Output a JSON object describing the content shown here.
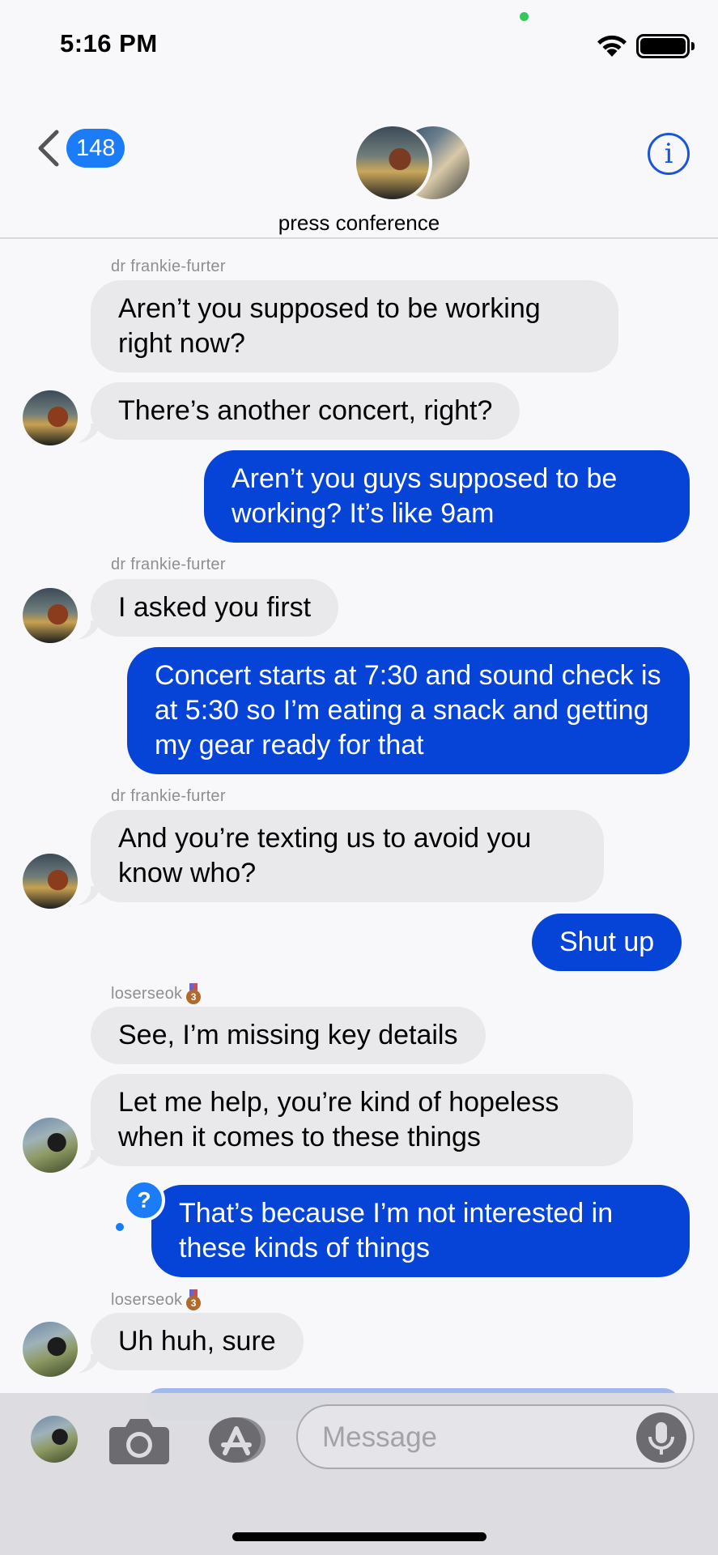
{
  "status_bar": {
    "time": "5:16 PM"
  },
  "header": {
    "back_count": "148",
    "group_name": "press conference",
    "info_label": "i"
  },
  "messages": [
    {
      "sender": "dr frankie-furter",
      "text": "Aren’t you supposed to be working right now?"
    },
    {
      "text": "There’s another concert, right?"
    },
    {
      "text": "Aren’t you guys supposed to be working? It’s like 9am"
    },
    {
      "sender": "dr frankie-furter",
      "text": "I asked you first"
    },
    {
      "text": "Concert starts at 7:30 and sound check is at 5:30 so I’m eating a snack and getting my gear ready for that"
    },
    {
      "sender": "dr frankie-furter",
      "text": "And you’re texting us to avoid you know who?"
    },
    {
      "text": "Shut up"
    },
    {
      "sender": "loserseok",
      "text": "See, I’m missing key details"
    },
    {
      "text": "Let me help, you’re kind of hopeless when it comes to these things"
    },
    {
      "text": "That’s because I’m not interested in these kinds of things",
      "badge": "?"
    },
    {
      "sender": "loserseok",
      "text": "Uh huh, sure"
    }
  ],
  "input": {
    "placeholder": "Message"
  },
  "icons": {
    "back": "chevron-left-icon",
    "info": "info-icon",
    "camera": "camera-icon",
    "apps": "app-store-icon",
    "mic": "microphone-icon",
    "wifi": "wifi-icon",
    "battery": "battery-icon"
  },
  "colors": {
    "outgoing_bubble": "#0644d8",
    "incoming_bubble": "#e9e9eb",
    "badge_blue": "#1a7cf6",
    "sender_gray": "#8e8e93"
  }
}
